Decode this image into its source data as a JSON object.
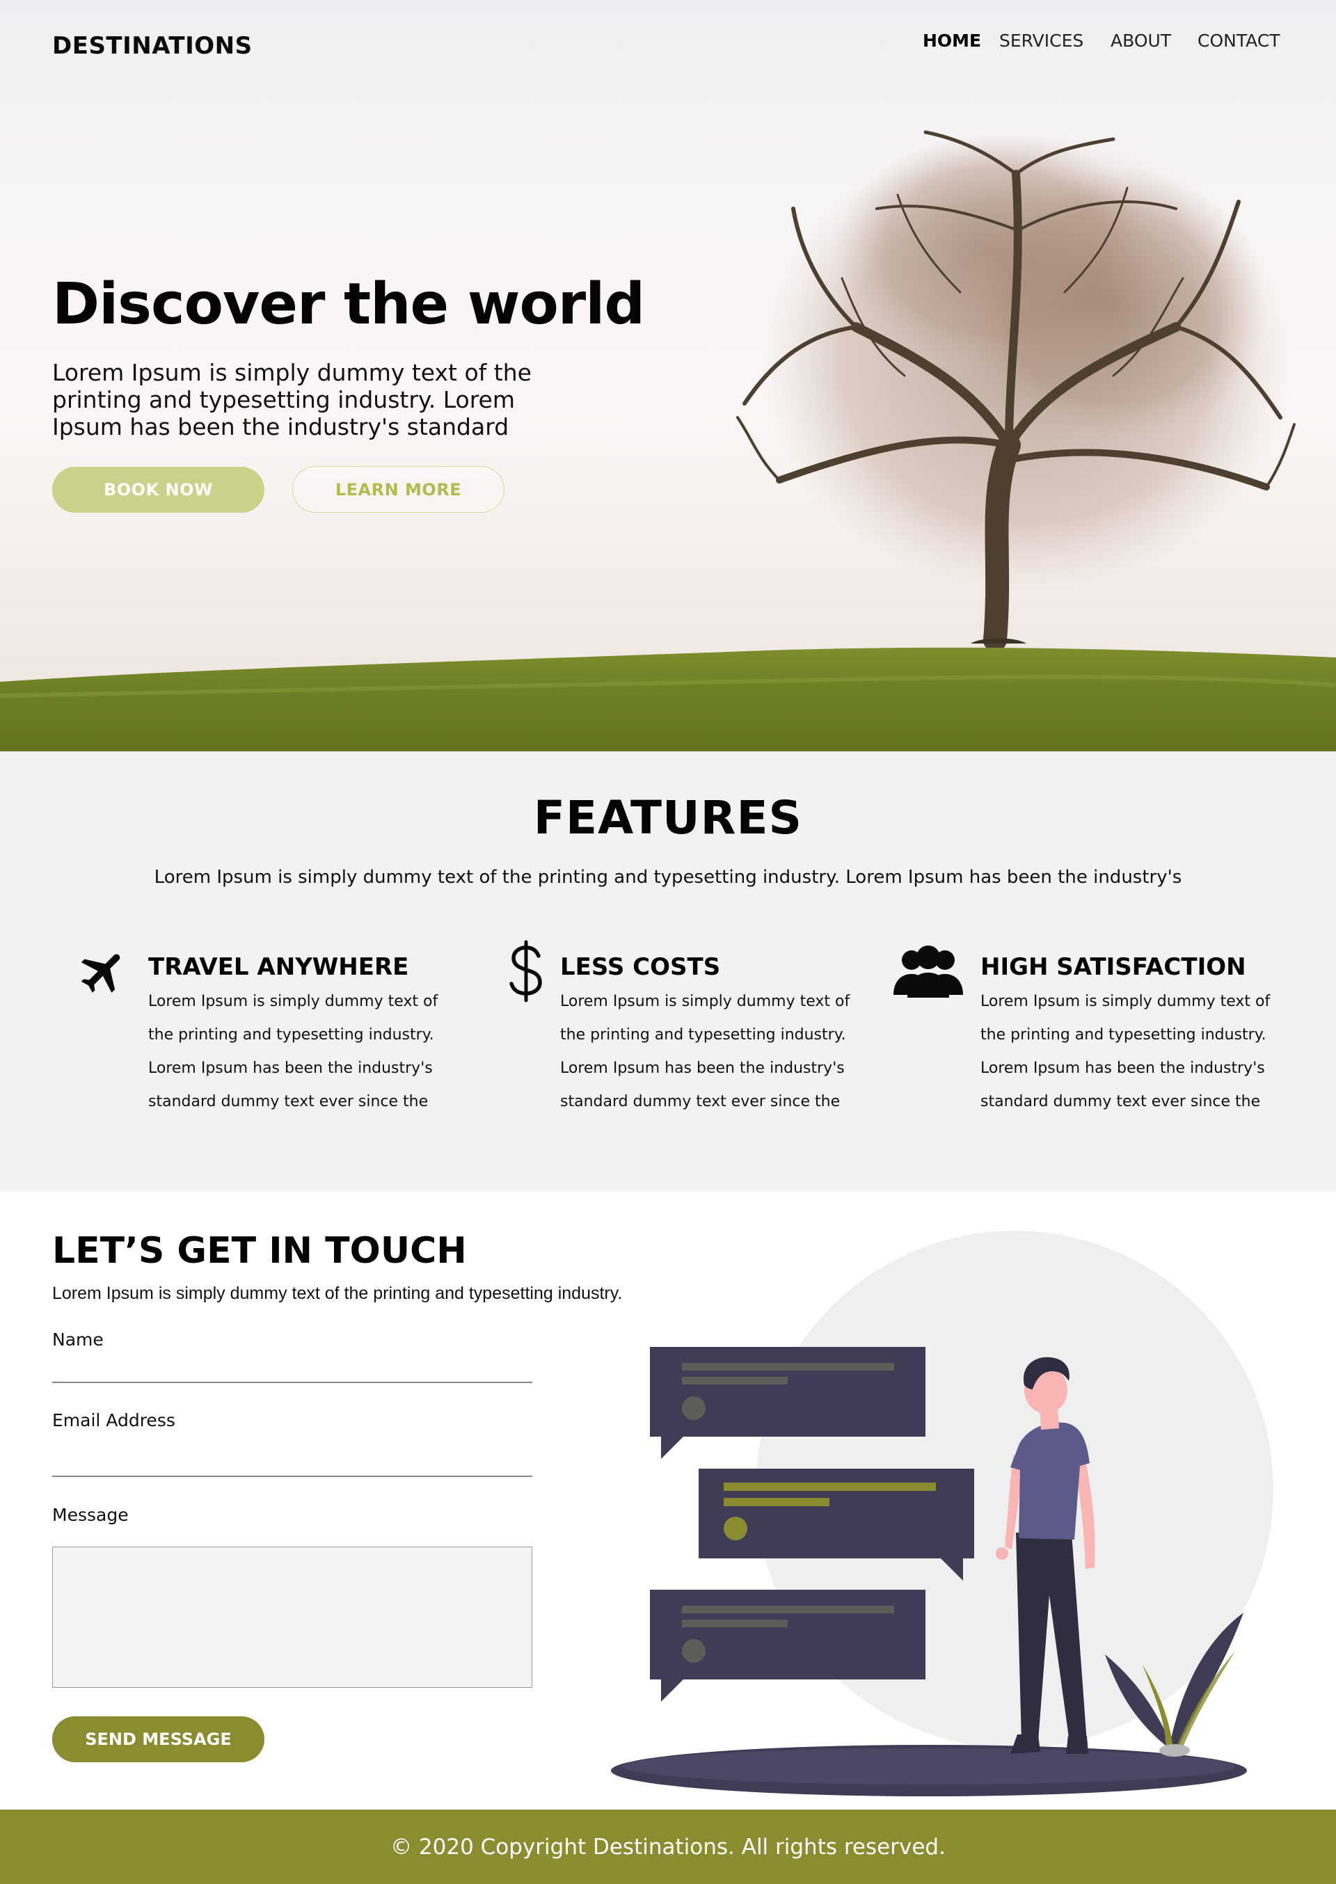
{
  "header": {
    "brand": "DESTINATIONS",
    "nav": [
      "HOME",
      "SERVICES",
      "ABOUT",
      "CONTACT"
    ],
    "active_nav": "HOME"
  },
  "hero": {
    "title": "Discover the world",
    "text": "Lorem Ipsum is simply dummy text of the printing and typesetting industry. Lorem Ipsum has been the industry's standard",
    "book_label": "BOOK NOW",
    "learn_label": "LEARN MORE"
  },
  "features": {
    "title": "FEATURES",
    "subtitle": "Lorem Ipsum is simply dummy text of the printing and typesetting industry. Lorem Ipsum has been the industry's",
    "items": [
      {
        "icon": "airplane-icon",
        "title": "TRAVEL ANYWHERE",
        "text": "Lorem Ipsum is simply dummy text of the printing and typesetting industry. Lorem Ipsum has been the industry's standard dummy text ever since the"
      },
      {
        "icon": "dollar-icon",
        "title": "LESS COSTS",
        "text": "Lorem Ipsum is simply dummy text of the printing and typesetting industry. Lorem Ipsum has been the industry's standard dummy text ever since the"
      },
      {
        "icon": "users-icon",
        "title": "HIGH SATISFACTION",
        "text": "Lorem Ipsum is simply dummy text of the printing and typesetting industry. Lorem Ipsum has been the industry's standard dummy text ever since the"
      }
    ]
  },
  "contact": {
    "title": "LET’S GET IN TOUCH",
    "subtitle": "Lorem Ipsum is simply dummy text of the printing and typesetting industry.",
    "name_label": "Name",
    "name_value": "",
    "email_label": "Email Address",
    "email_value": "",
    "message_label": "Message",
    "message_value": "",
    "send_label": "SEND MESSAGE"
  },
  "footer": {
    "copyright": "© 2020 Copyright Destinations. All rights reserved."
  },
  "colors": {
    "accent": "#8b8c2f",
    "book_button": "#ccd18a",
    "learn_text": "#b6ba4e",
    "features_bg": "#f3f1f2",
    "bubble_dark": "#3f3d55",
    "shirt": "#5c5a8a"
  }
}
